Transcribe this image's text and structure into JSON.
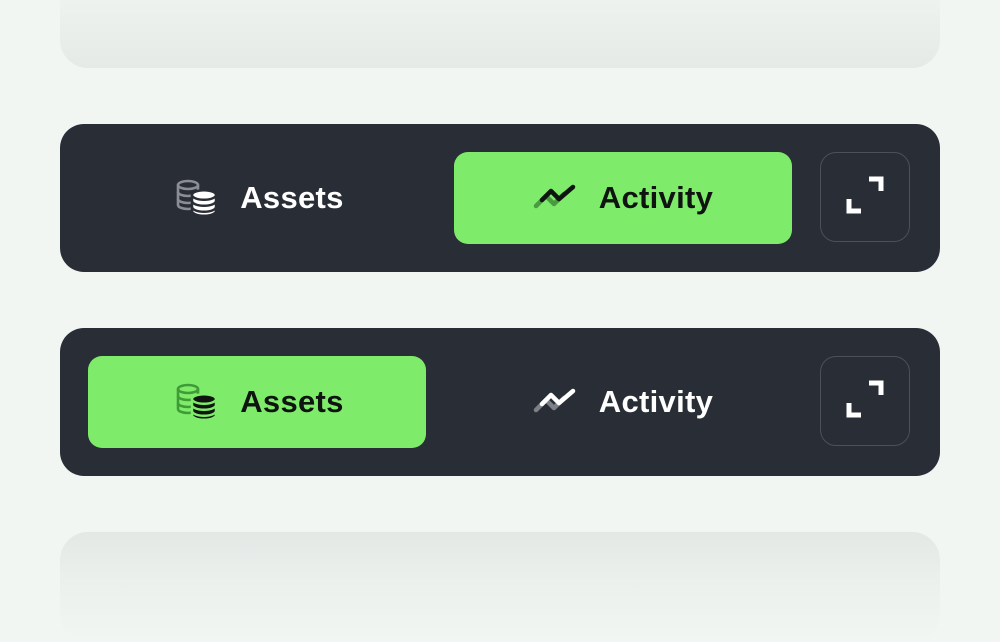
{
  "segmented_controls": [
    {
      "selected": "activity",
      "assets_label": "Assets",
      "activity_label": "Activity",
      "icons": {
        "assets": "coins-stack-icon",
        "activity": "activity-chart-icon",
        "expand": "expand-icon"
      }
    },
    {
      "selected": "assets",
      "assets_label": "Assets",
      "activity_label": "Activity",
      "icons": {
        "assets": "coins-stack-icon",
        "activity": "activity-chart-icon",
        "expand": "expand-icon"
      }
    }
  ],
  "colors": {
    "page_background": "#f1f6f2",
    "bar_background": "#292d36",
    "accent_green": "#7eec6a",
    "text_light": "#ffffff",
    "text_dark": "#0f1410"
  }
}
